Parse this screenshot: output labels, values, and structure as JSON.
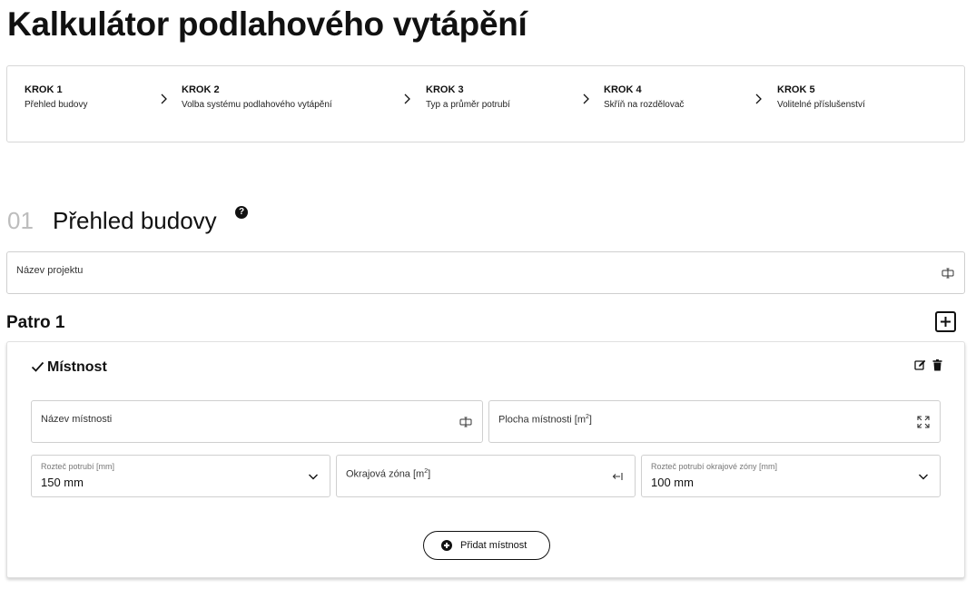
{
  "page": {
    "title": "Kalkulátor podlahového vytápění"
  },
  "steps": [
    {
      "title": "KROK 1",
      "subtitle": "Přehled budovy"
    },
    {
      "title": "KROK 2",
      "subtitle": "Volba systému podlahového vytápění"
    },
    {
      "title": "KROK 3",
      "subtitle": "Typ a průměr potrubí"
    },
    {
      "title": "KROK 4",
      "subtitle": "Skříň na rozdělovač"
    },
    {
      "title": "KROK 5",
      "subtitle": "Volitelné příslušenství"
    }
  ],
  "section": {
    "number": "01",
    "title": "Přehled budovy",
    "help_icon": "?"
  },
  "project": {
    "label": "Název projektu",
    "icon": "text-cursor-icon"
  },
  "floor": {
    "title": "Patro 1",
    "add_icon": "plus-square-icon"
  },
  "room": {
    "title": "Místnost",
    "name_field": {
      "label": "Název místnosti",
      "icon": "text-cursor-icon"
    },
    "area_field": {
      "label_text": "Plocha místnosti [m",
      "label_sup": "2",
      "label_end": "]",
      "icon": "expand-icon"
    },
    "pipe_spacing": {
      "label": "Rozteč potrubí [mm]",
      "value": "150 mm",
      "icon": "chevron-down-icon"
    },
    "edge_zone": {
      "label_text": "Okrajová zóna [m",
      "label_sup": "2",
      "label_end": "]",
      "icon": "arrow-to-edge-icon"
    },
    "edge_spacing": {
      "label": "Rozteč potrubí okrajové zóny [mm]",
      "value": "100 mm",
      "icon": "chevron-down-icon"
    },
    "add_button": "Přidat místnost"
  }
}
